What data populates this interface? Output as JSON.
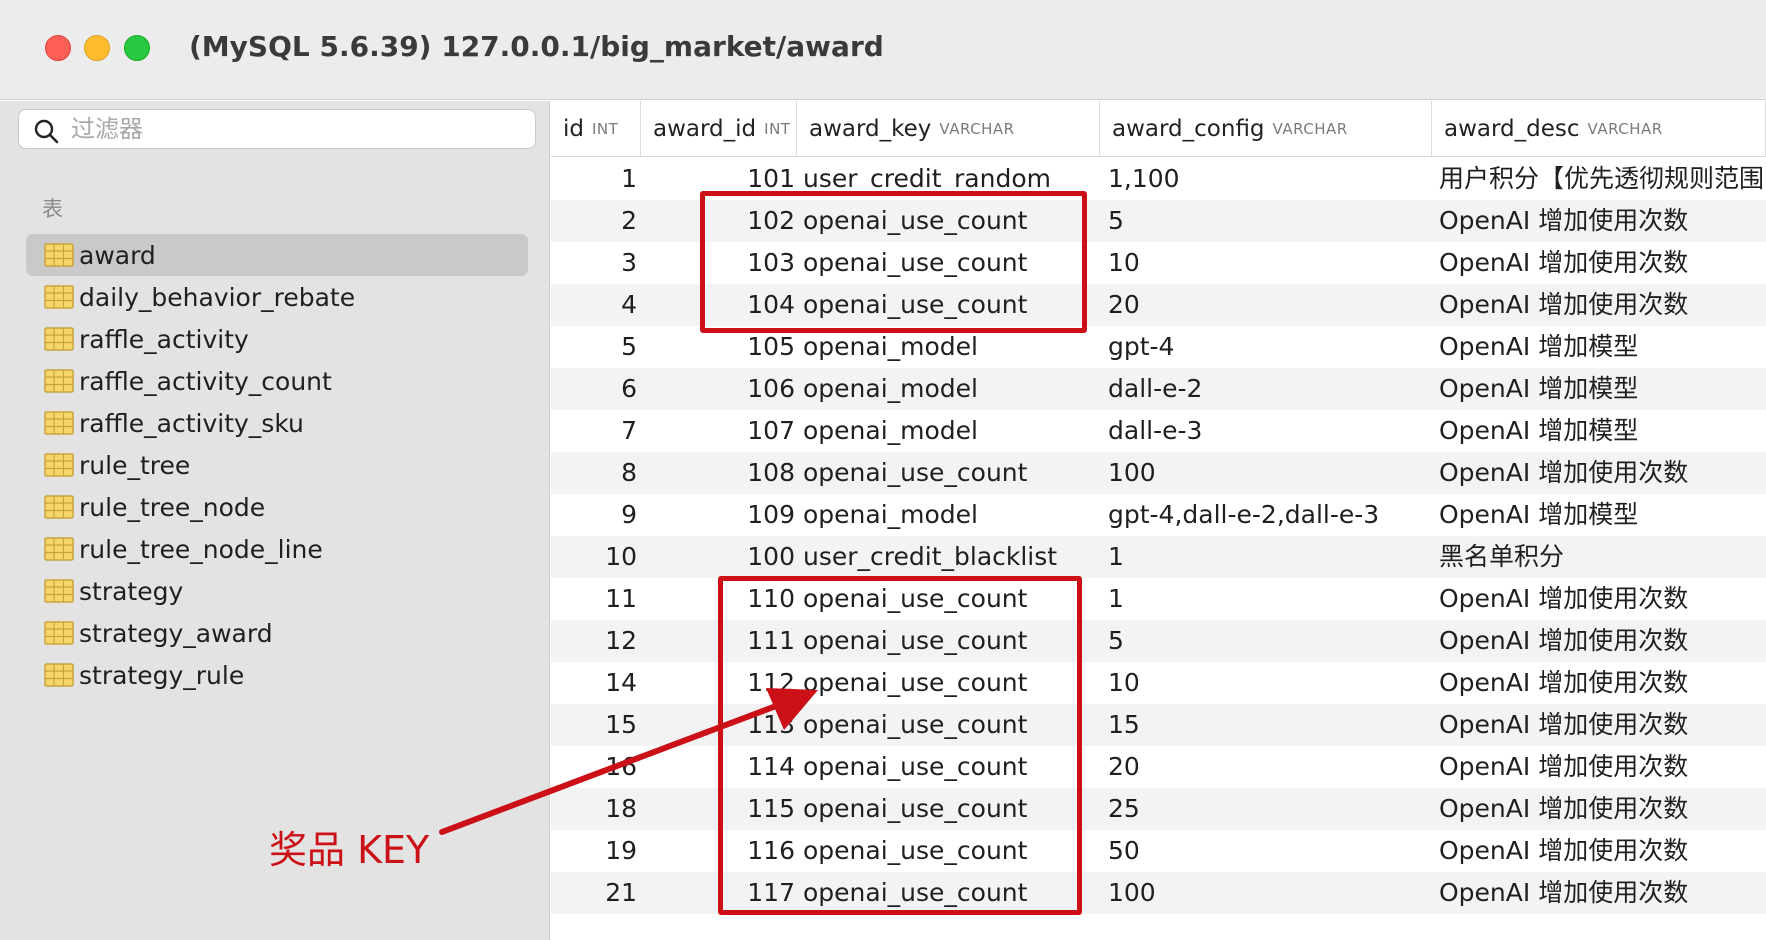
{
  "window": {
    "title": "(MySQL 5.6.39) 127.0.0.1/big_market/award"
  },
  "sidebar": {
    "filter_placeholder": "过滤器",
    "section_label": "表",
    "selected_index": 0,
    "tables": [
      "award",
      "daily_behavior_rebate",
      "raffle_activity",
      "raffle_activity_count",
      "raffle_activity_sku",
      "rule_tree",
      "rule_tree_node",
      "rule_tree_node_line",
      "strategy",
      "strategy_award",
      "strategy_rule"
    ]
  },
  "grid": {
    "columns": [
      {
        "name": "id",
        "type": "INT"
      },
      {
        "name": "award_id",
        "type": "INT"
      },
      {
        "name": "award_key",
        "type": "VARCHAR"
      },
      {
        "name": "award_config",
        "type": "VARCHAR"
      },
      {
        "name": "award_desc",
        "type": "VARCHAR"
      }
    ],
    "rows": [
      [
        "1",
        "101",
        "user_credit_random",
        "1,100",
        "用户积分【优先透彻规则范围"
      ],
      [
        "2",
        "102",
        "openai_use_count",
        "5",
        "OpenAI 增加使用次数"
      ],
      [
        "3",
        "103",
        "openai_use_count",
        "10",
        "OpenAI 增加使用次数"
      ],
      [
        "4",
        "104",
        "openai_use_count",
        "20",
        "OpenAI 增加使用次数"
      ],
      [
        "5",
        "105",
        "openai_model",
        "gpt-4",
        "OpenAI 增加模型"
      ],
      [
        "6",
        "106",
        "openai_model",
        "dall-e-2",
        "OpenAI 增加模型"
      ],
      [
        "7",
        "107",
        "openai_model",
        "dall-e-3",
        "OpenAI 增加模型"
      ],
      [
        "8",
        "108",
        "openai_use_count",
        "100",
        "OpenAI 增加使用次数"
      ],
      [
        "9",
        "109",
        "openai_model",
        "gpt-4,dall-e-2,dall-e-3",
        "OpenAI 增加模型"
      ],
      [
        "10",
        "100",
        "user_credit_blacklist",
        "1",
        "黑名单积分"
      ],
      [
        "11",
        "110",
        "openai_use_count",
        "1",
        "OpenAI 增加使用次数"
      ],
      [
        "12",
        "111",
        "openai_use_count",
        "5",
        "OpenAI 增加使用次数"
      ],
      [
        "14",
        "112",
        "openai_use_count",
        "10",
        "OpenAI 增加使用次数"
      ],
      [
        "15",
        "113",
        "openai_use_count",
        "15",
        "OpenAI 增加使用次数"
      ],
      [
        "16",
        "114",
        "openai_use_count",
        "20",
        "OpenAI 增加使用次数"
      ],
      [
        "18",
        "115",
        "openai_use_count",
        "25",
        "OpenAI 增加使用次数"
      ],
      [
        "19",
        "116",
        "openai_use_count",
        "50",
        "OpenAI 增加使用次数"
      ],
      [
        "21",
        "117",
        "openai_use_count",
        "100",
        "OpenAI 增加使用次数"
      ]
    ]
  },
  "annotation": {
    "label": "奖品 KEY",
    "color": "#cc1018"
  },
  "colors": {
    "titlebar_bg": "#ececec",
    "sidebar_bg": "#e3e3e3",
    "selected_bg": "#c9c9c9",
    "row_alt_bg": "#f3f3f3",
    "table_icon": "#f2c94c"
  }
}
